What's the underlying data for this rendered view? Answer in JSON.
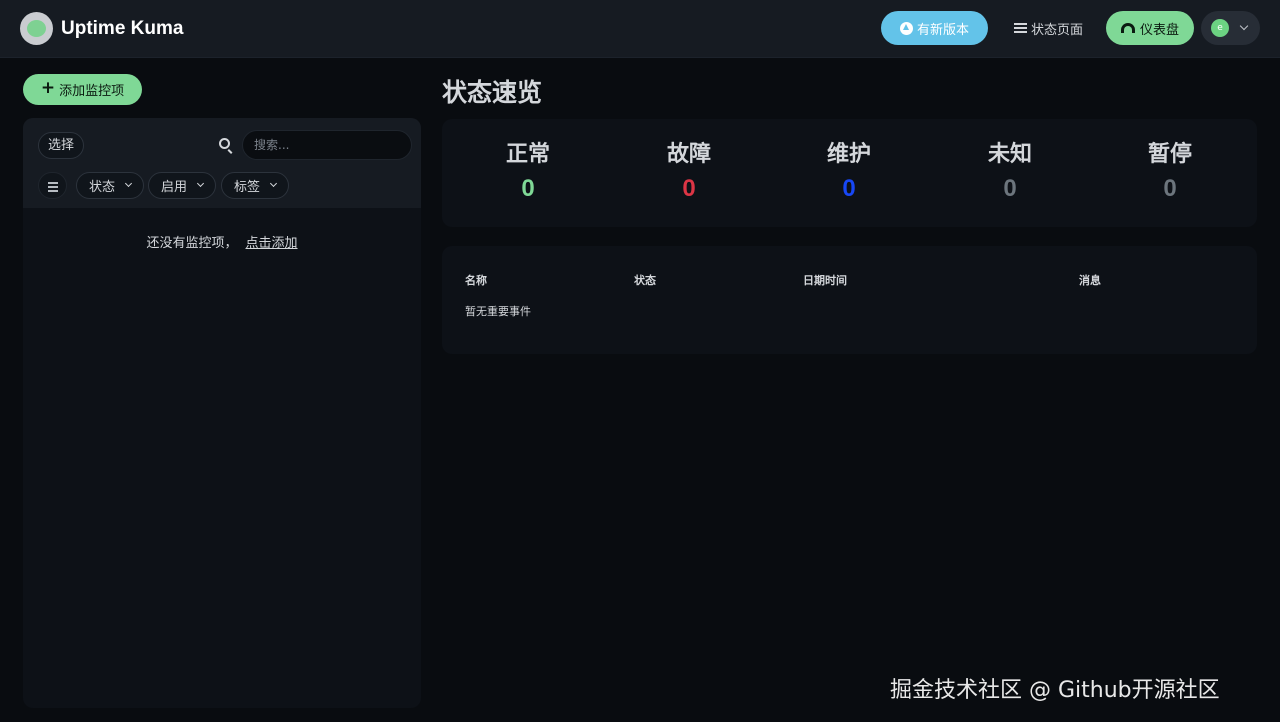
{
  "header": {
    "brand": "Uptime Kuma",
    "update_label": "有新版本",
    "status_page_label": "状态页面",
    "dashboard_label": "仪表盘",
    "avatar_initial": "e"
  },
  "sidebar": {
    "add_label": "添加监控项",
    "select_label": "选择",
    "search_placeholder": "搜索...",
    "filters": [
      {
        "label": "状态"
      },
      {
        "label": "启用"
      },
      {
        "label": "标签"
      }
    ],
    "empty_text": "还没有监控项，",
    "empty_link": "点击添加"
  },
  "main": {
    "title": "状态速览",
    "stats": [
      {
        "label": "正常",
        "value": "0",
        "color": "#7fd896"
      },
      {
        "label": "故障",
        "value": "0",
        "color": "#dc3545"
      },
      {
        "label": "维护",
        "value": "0",
        "color": "#1747f5"
      },
      {
        "label": "未知",
        "value": "0",
        "color": "#6c757d"
      },
      {
        "label": "暂停",
        "value": "0",
        "color": "#6c757d"
      }
    ],
    "events": {
      "columns": [
        "名称",
        "状态",
        "日期时间",
        "消息"
      ],
      "empty": "暂无重要事件"
    }
  },
  "watermark": "掘金技术社区 @ Github开源社区"
}
